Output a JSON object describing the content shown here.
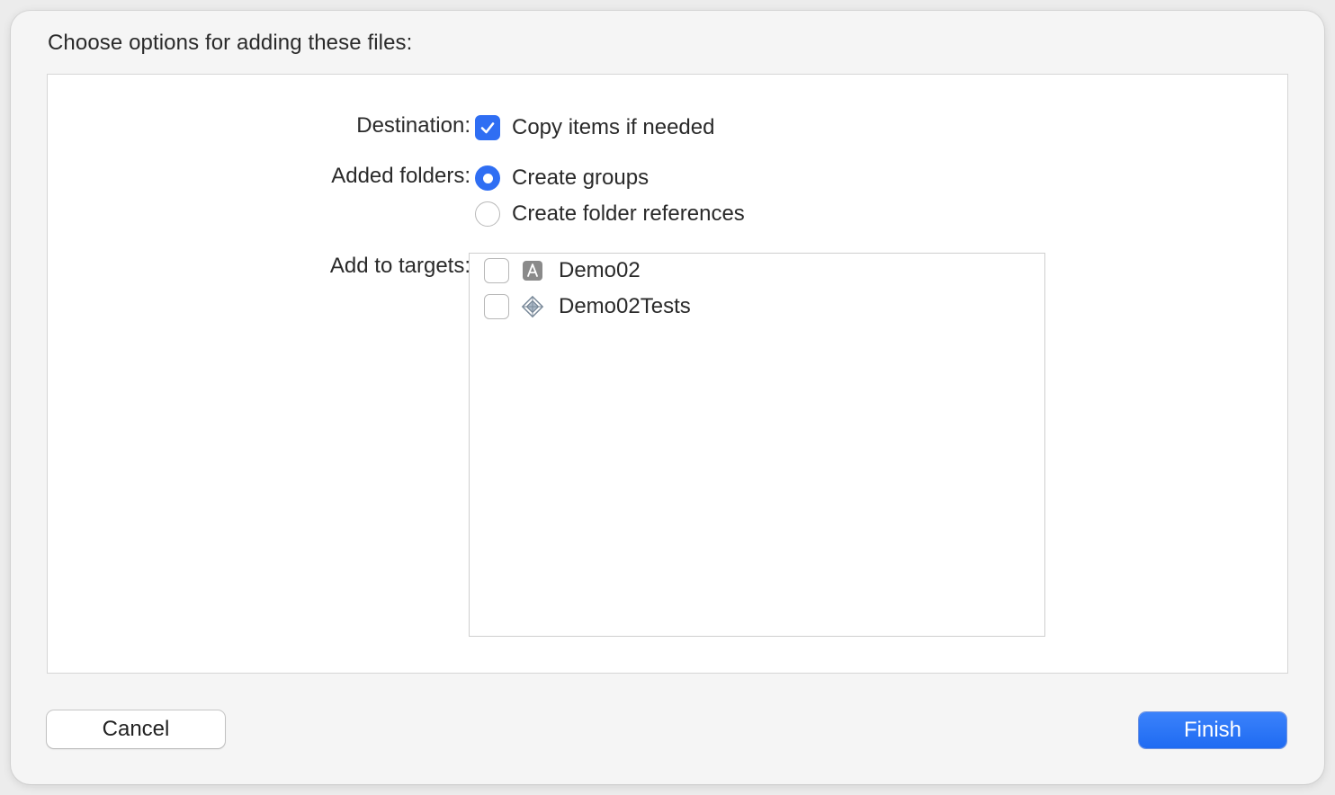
{
  "dialog": {
    "heading": "Choose options for adding these files:"
  },
  "destination": {
    "label": "Destination:",
    "copy_items": {
      "label": "Copy items if needed",
      "checked": true
    }
  },
  "added_folders": {
    "label": "Added folders:",
    "options": [
      {
        "label": "Create groups",
        "selected": true
      },
      {
        "label": "Create folder references",
        "selected": false
      }
    ]
  },
  "targets": {
    "label": "Add to targets:",
    "items": [
      {
        "name": "Demo02",
        "icon": "app-target-icon",
        "checked": false
      },
      {
        "name": "Demo02Tests",
        "icon": "test-target-icon",
        "checked": false
      }
    ]
  },
  "buttons": {
    "cancel": "Cancel",
    "finish": "Finish"
  },
  "colors": {
    "accent": "#2f6ef3",
    "panel_background": "#ffffff",
    "dialog_background": "#f5f5f5"
  }
}
